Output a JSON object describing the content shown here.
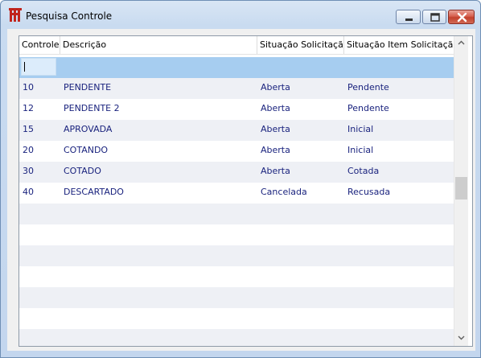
{
  "window": {
    "title": "Pesquisa Controle"
  },
  "grid": {
    "columns": [
      "Controle",
      "Descrição",
      "Situação Solicitação",
      "Situação Item Solicitação"
    ],
    "rows": [
      {
        "controle": "10",
        "descricao": "PENDENTE",
        "situacao_solicitacao": "Aberta",
        "situacao_item": "Pendente"
      },
      {
        "controle": "12",
        "descricao": "PENDENTE 2",
        "situacao_solicitacao": "Aberta",
        "situacao_item": "Pendente"
      },
      {
        "controle": "15",
        "descricao": "APROVADA",
        "situacao_solicitacao": "Aberta",
        "situacao_item": "Inicial"
      },
      {
        "controle": "20",
        "descricao": "COTANDO",
        "situacao_solicitacao": "Aberta",
        "situacao_item": "Inicial"
      },
      {
        "controle": "30",
        "descricao": "COTADO",
        "situacao_solicitacao": "Aberta",
        "situacao_item": "Cotada"
      },
      {
        "controle": "40",
        "descricao": "DESCARTADO",
        "situacao_solicitacao": "Cancelada",
        "situacao_item": "Recusada"
      }
    ]
  },
  "colors": {
    "selected_row": "#a6cdf0",
    "cell_text": "#1a237e",
    "alt_row": "#eef0f5"
  }
}
